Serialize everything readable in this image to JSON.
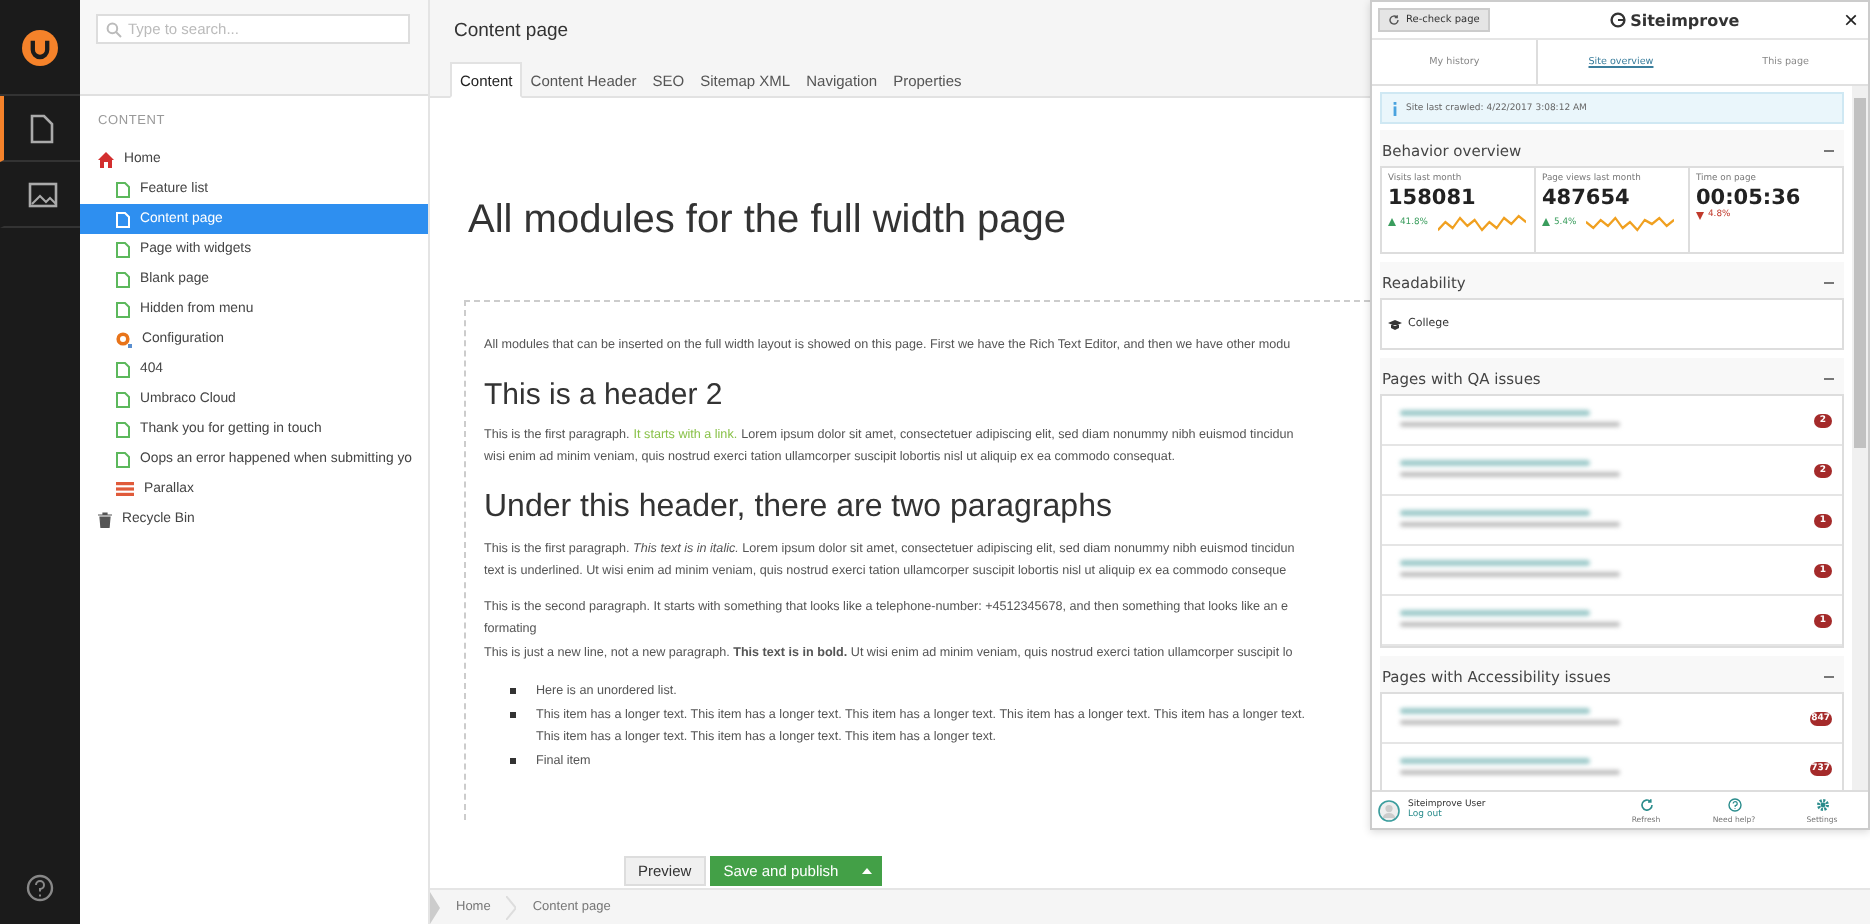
{
  "sidebar_nav": {
    "items": [
      {
        "kind": "content",
        "selected": true
      },
      {
        "kind": "media",
        "selected": false
      }
    ]
  },
  "tree": {
    "search": {
      "placeholder": "Type to search..."
    },
    "section_title": "CONTENT",
    "nodes": [
      {
        "label": "Home",
        "kind": "home",
        "selected": false,
        "children": [
          {
            "label": "Feature list",
            "kind": "page",
            "selected": false
          },
          {
            "label": "Content page",
            "kind": "page",
            "selected": true
          },
          {
            "label": "Page with widgets",
            "kind": "page",
            "selected": false
          },
          {
            "label": "Blank page",
            "kind": "page",
            "selected": false
          },
          {
            "label": "Hidden from menu",
            "kind": "page",
            "selected": false
          },
          {
            "label": "Configuration",
            "kind": "gear",
            "selected": false
          },
          {
            "label": "404",
            "kind": "page",
            "selected": false
          },
          {
            "label": "Umbraco Cloud",
            "kind": "page",
            "selected": false
          },
          {
            "label": "Thank you for getting in touch",
            "kind": "page",
            "selected": false
          },
          {
            "label": "Oops an error happened when submitting yo",
            "kind": "page",
            "selected": false
          },
          {
            "label": "Parallax",
            "kind": "stripes",
            "selected": false
          }
        ]
      },
      {
        "label": "Recycle Bin",
        "kind": "trash",
        "selected": false
      }
    ]
  },
  "editor": {
    "title": "Content page",
    "tabs": [
      {
        "label": "Content",
        "selected": true
      },
      {
        "label": "Content Header",
        "selected": false
      },
      {
        "label": "SEO",
        "selected": false
      },
      {
        "label": "Sitemap XML",
        "selected": false
      },
      {
        "label": "Navigation",
        "selected": false
      },
      {
        "label": "Properties",
        "selected": false
      }
    ],
    "page_heading": "All modules for the full width page",
    "blocks": [
      {
        "kind": "paragraph",
        "lines": [
          [
            {
              "kind": "text",
              "text": "All modules that can be inserted on the full width layout is showed on this page. First we have the Rich Text Editor, and then we have other modu"
            }
          ]
        ]
      },
      {
        "kind": "heading",
        "text": "This is a header 2"
      },
      {
        "kind": "paragraph",
        "lines": [
          [
            {
              "kind": "text",
              "text": "This is the first paragraph."
            },
            {
              "kind": "link",
              "text": "It starts with a link."
            },
            {
              "kind": "text",
              "text": "Lorem ipsum dolor sit amet, consectetuer adipiscing elit, sed diam nonummy nibh euismod tincidun"
            }
          ],
          [
            {
              "kind": "text",
              "text": "wisi enim ad minim veniam, quis nostrud exerci tation ullamcorper suscipit lobortis nisl ut aliquip ex ea commodo consequat."
            }
          ]
        ]
      },
      {
        "kind": "heading",
        "text": "Under this header, there are two paragraphs"
      },
      {
        "kind": "paragraph",
        "lines": [
          [
            {
              "kind": "text",
              "text": "This is the first paragraph. *This text is in italic.* Lorem ipsum dolor sit amet, consectetuer adipiscing elit, sed diam nonummy nibh euismod tincidun"
            }
          ],
          [
            {
              "kind": "text",
              "text": "text is underlined. Ut wisi enim ad minim veniam, quis nostrud exerci tation ullamcorper suscipit lobortis nisl ut aliquip ex ea commodo conseque"
            }
          ]
        ]
      },
      {
        "kind": "paragraph",
        "lines": [
          [
            {
              "kind": "text",
              "text": "This is the second paragraph. It starts with something that looks like a telephone-number: +4512345678, and then something that looks like an e"
            }
          ],
          [
            {
              "kind": "text",
              "text": "formating"
            }
          ],
          [
            {
              "kind": "text",
              "text": "This is just a new line, not a new paragraph. **This text is in bold.** Ut wisi enim ad minim veniam, quis nostrud exerci tation ullamcorper suscipit lo"
            }
          ]
        ]
      },
      {
        "kind": "list",
        "items": [
          {
            "lines": [
              "Here is an unordered list."
            ]
          },
          {
            "lines": [
              "This item has a longer text. This item has a longer text. This item has a longer text. This item has a longer text. This item has a longer text.",
              "This item has a longer text. This item has a longer text. This item has a longer text."
            ]
          },
          {
            "lines": [
              "Final item"
            ]
          }
        ]
      }
    ],
    "actions": {
      "preview": "Preview",
      "publish": "Save and publish"
    },
    "breadcrumb": [
      "Home",
      "Content page"
    ]
  },
  "siteimprove": {
    "recheck": "Re-check page",
    "brand": "Siteimprove",
    "close": "×",
    "tabs": [
      {
        "label": "My history",
        "selected": false
      },
      {
        "label": "Site overview",
        "selected": true
      },
      {
        "label": "This page",
        "selected": false
      }
    ],
    "notice": "Site last crawled: 4/22/2017 3:08:12 AM",
    "sections": [
      {
        "kind": "stats",
        "title": "Behavior overview",
        "stats": [
          {
            "label": "Visits last month",
            "value": "158081",
            "change": "41.8%",
            "kind": "up"
          },
          {
            "label": "Page views last month",
            "value": "487654",
            "change": "5.4%",
            "kind": "up"
          },
          {
            "label": "Time on page",
            "value": "00:05:36",
            "change": "4.8%",
            "kind": "down"
          }
        ]
      },
      {
        "kind": "readability",
        "title": "Readability",
        "value": "College"
      },
      {
        "kind": "issues",
        "title": "Pages with QA issues",
        "rows": [
          {
            "count": "2"
          },
          {
            "count": "2"
          },
          {
            "count": "1"
          },
          {
            "count": "1"
          },
          {
            "count": "1"
          }
        ]
      },
      {
        "kind": "issues",
        "title": "Pages with Accessibility issues",
        "rows": [
          {
            "count": "847"
          },
          {
            "count": "737"
          }
        ]
      }
    ],
    "user": {
      "name": "Siteimprove User",
      "logout": "Log out"
    },
    "footer_actions": [
      {
        "kind": "refresh",
        "label": "Refresh"
      },
      {
        "kind": "help",
        "label": "Need help?"
      },
      {
        "kind": "settings",
        "label": "Settings"
      }
    ]
  }
}
